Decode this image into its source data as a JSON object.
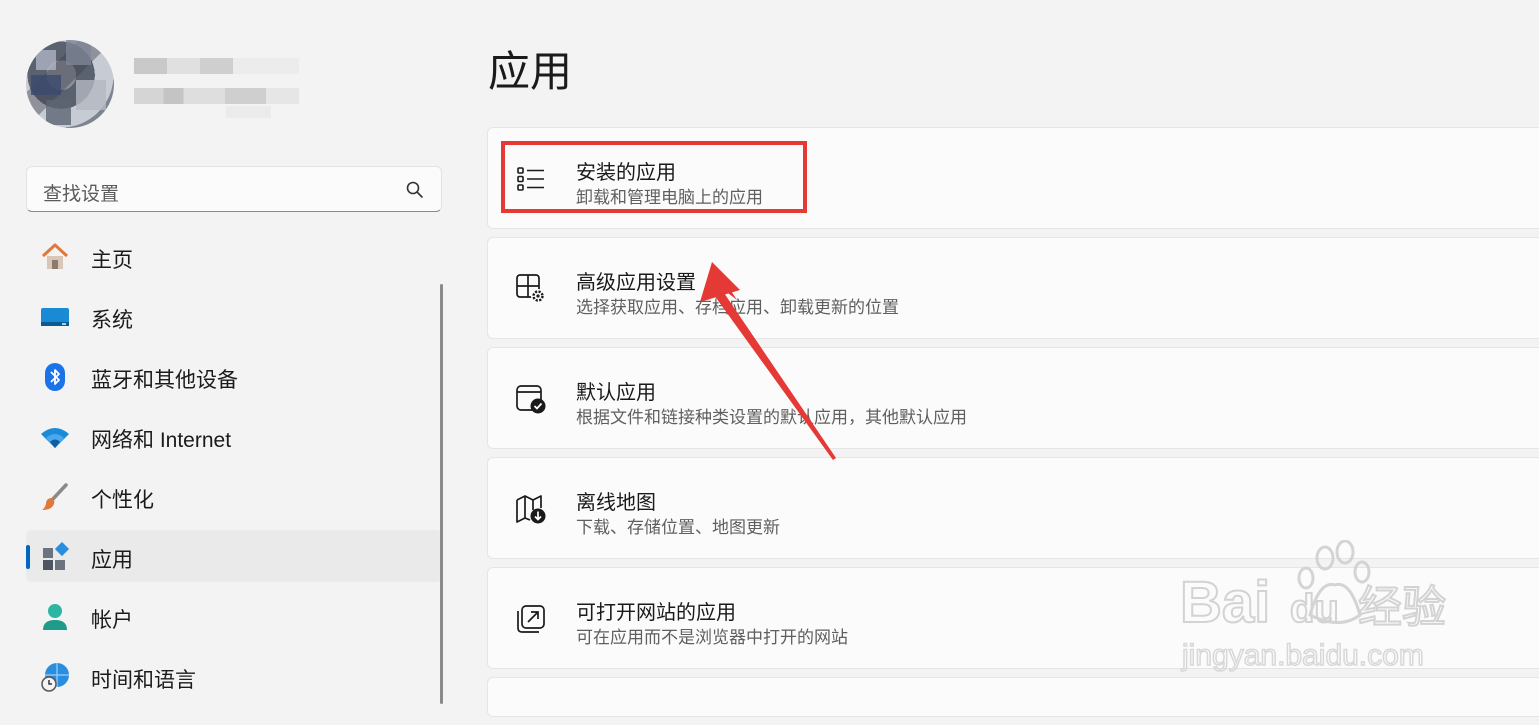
{
  "sidebar": {
    "search": {
      "placeholder": "查找设置"
    },
    "items": [
      {
        "label": "主页",
        "icon": "home-icon"
      },
      {
        "label": "系统",
        "icon": "system-icon"
      },
      {
        "label": "蓝牙和其他设备",
        "icon": "bluetooth-icon"
      },
      {
        "label": "网络和 Internet",
        "icon": "wifi-icon"
      },
      {
        "label": "个性化",
        "icon": "brush-icon"
      },
      {
        "label": "应用",
        "icon": "apps-icon",
        "selected": true
      },
      {
        "label": "帐户",
        "icon": "account-icon"
      },
      {
        "label": "时间和语言",
        "icon": "time-language-icon"
      }
    ]
  },
  "main": {
    "title": "应用",
    "cards": [
      {
        "title": "安装的应用",
        "subtitle": "卸载和管理电脑上的应用",
        "icon": "installed-apps-icon"
      },
      {
        "title": "高级应用设置",
        "subtitle": "选择获取应用、存档应用、卸载更新的位置",
        "icon": "advanced-app-settings-icon"
      },
      {
        "title": "默认应用",
        "subtitle": "根据文件和链接种类设置的默认应用，其他默认应用",
        "icon": "default-apps-icon"
      },
      {
        "title": "离线地图",
        "subtitle": "下载、存储位置、地图更新",
        "icon": "offline-maps-icon"
      },
      {
        "title": "可打开网站的应用",
        "subtitle": "可在应用而不是浏览器中打开的网站",
        "icon": "apps-for-websites-icon"
      }
    ]
  },
  "annotation": {
    "color": "#e53935"
  },
  "watermark": {
    "brand": "Baidu经验",
    "url": "jingyan.baidu.com"
  },
  "colors": {
    "accent": "#0067c0",
    "background": "#f3f3f3"
  }
}
